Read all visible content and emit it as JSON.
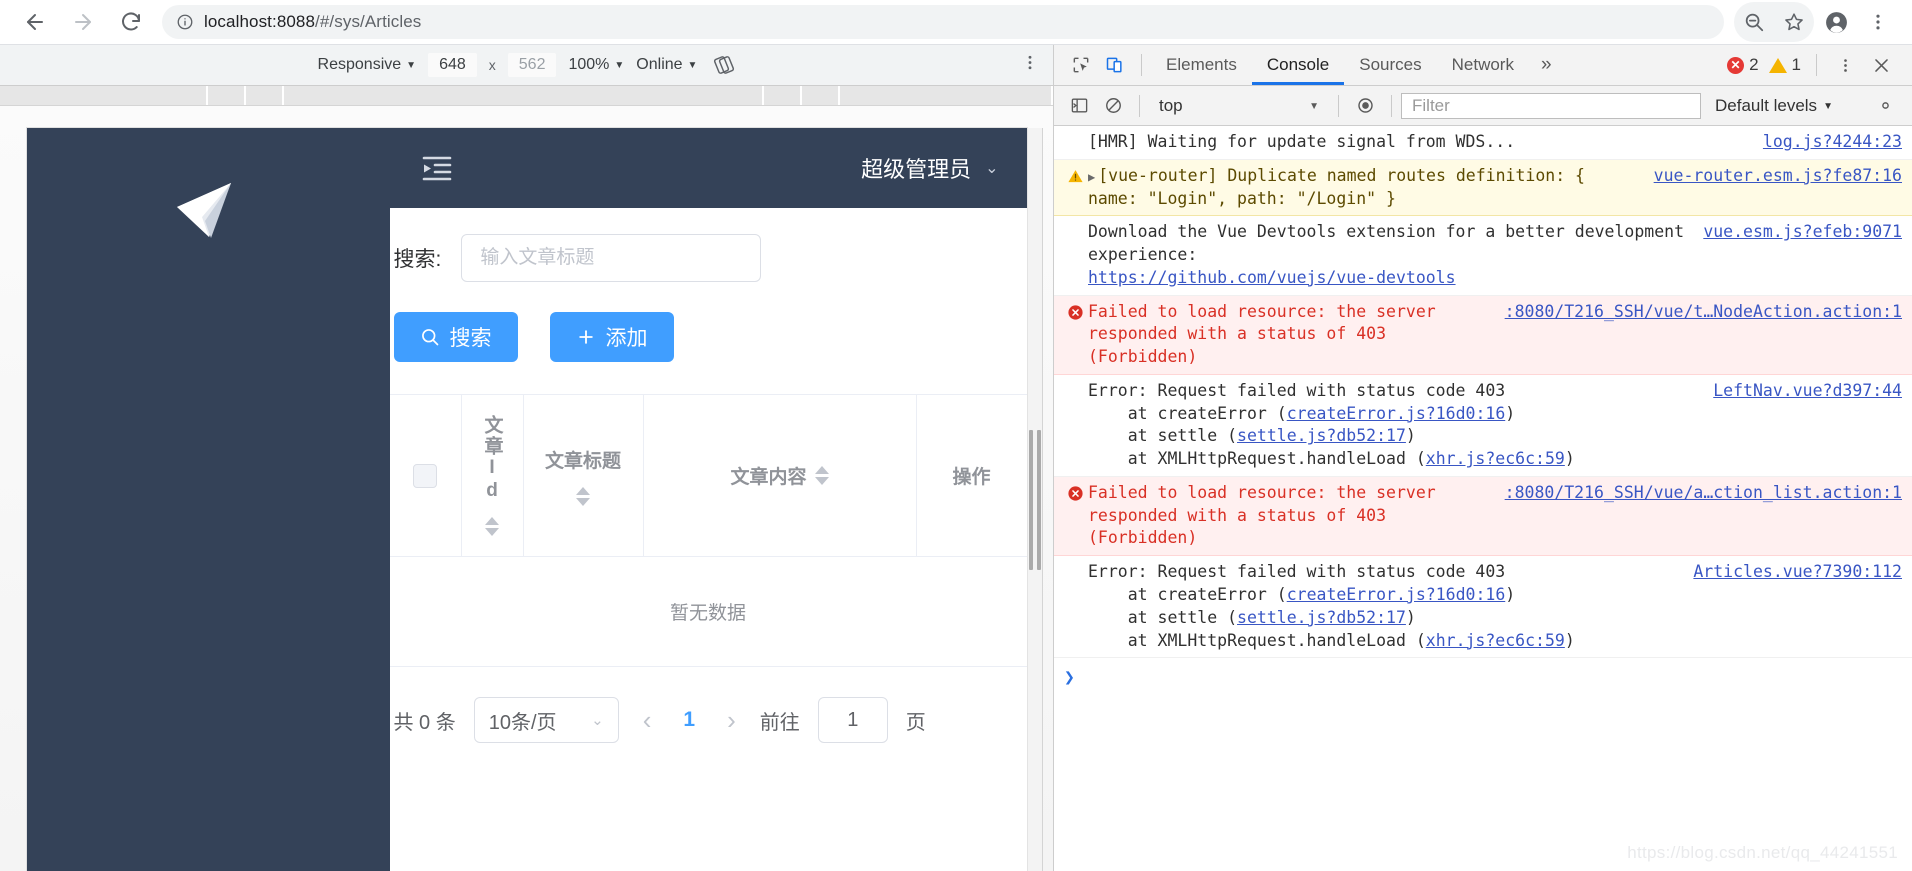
{
  "browser": {
    "back_icon": "arrow-left-icon",
    "forward_icon": "arrow-right-icon",
    "reload_icon": "reload-icon",
    "info_icon": "site-info-icon",
    "url_host": "localhost:8088",
    "url_path": "/#/sys/Articles",
    "url_full": "localhost:8088/#/sys/Articles",
    "zoom_out_icon": "zoom-out-icon",
    "bookmark_icon": "star-icon",
    "profile_icon": "account-avatar-icon",
    "menu_icon": "three-dot-menu-icon"
  },
  "device_toolbar": {
    "device_label": "Responsive",
    "width": "648",
    "height": "562",
    "x_label": "x",
    "zoom_label": "100%",
    "throttle_label": "Online",
    "rotate_icon": "rotate-device-icon",
    "kebab_icon": "three-dot-menu-icon"
  },
  "webapp": {
    "logo_icon": "paper-plane-logo",
    "collapse_icon": "collapse-menu-icon",
    "user_name": "超级管理员",
    "user_caret_icon": "chevron-down-icon",
    "search_label": "搜索:",
    "search_placeholder": "输入文章标题",
    "search_value": "",
    "buttons": {
      "search": {
        "label": "搜索",
        "icon": "search-icon"
      },
      "add": {
        "label": "添加",
        "icon": "plus-icon"
      }
    },
    "table": {
      "columns": [
        {
          "key": "checkbox",
          "label": "",
          "sortable": false
        },
        {
          "key": "id",
          "label": "文章Id",
          "sortable": true
        },
        {
          "key": "title",
          "label": "文章标题",
          "sortable": true
        },
        {
          "key": "content",
          "label": "文章内容",
          "sortable": true
        },
        {
          "key": "ops",
          "label": "操作",
          "sortable": false
        }
      ],
      "rows": [],
      "empty_text": "暂无数据"
    },
    "pagination": {
      "total_text": "共 0 条",
      "page_size_label": "10条/页",
      "prev_icon": "chevron-left-icon",
      "next_icon": "chevron-right-icon",
      "current_page": "1",
      "jump_label": "前往",
      "jump_value": "1",
      "jump_suffix": "页"
    }
  },
  "devtools": {
    "inspect_icon": "inspect-element-icon",
    "device_toggle_icon": "toggle-device-toolbar-icon",
    "tabs": [
      {
        "label": "Elements",
        "selected": false
      },
      {
        "label": "Console",
        "selected": true
      },
      {
        "label": "Sources",
        "selected": false
      },
      {
        "label": "Network",
        "selected": false
      }
    ],
    "more_tabs_icon": "chevron-double-right-icon",
    "error_count": "2",
    "warning_count": "1",
    "kebab_icon": "three-dot-menu-icon",
    "close_icon": "close-icon",
    "filterbar": {
      "sidebar_icon": "console-sidebar-icon",
      "clear_icon": "clear-console-icon",
      "context": "top",
      "eye_icon": "live-expression-icon",
      "filter_placeholder": "Filter",
      "filter_value": "",
      "levels_label": "Default levels",
      "settings_icon": "gear-icon"
    },
    "messages": [
      {
        "level": "log",
        "text": "[HMR] Waiting for update signal from WDS...",
        "source": "log.js?4244:23"
      },
      {
        "level": "warn",
        "icon": "warning-triangle-icon",
        "expand_icon": "disclosure-triangle-icon",
        "text": "[vue-router] Duplicate named routes definition: { name: \"Login\", path: \"/Login\" }",
        "source": "vue-router.esm.js?fe87:16"
      },
      {
        "level": "log",
        "text": "Download the Vue Devtools extension for a better development experience:",
        "link": "https://github.com/vuejs/vue-devtools",
        "source": "vue.esm.js?efeb:9071"
      },
      {
        "level": "error",
        "icon": "error-circle-icon",
        "text": "Failed to load resource: the server responded with a status of 403 (Forbidden)",
        "source": ":8080/T216_SSH/vue/t…NodeAction.action:1"
      },
      {
        "level": "log",
        "text": "Error: Request failed with status code 403",
        "stack": [
          {
            "prefix": "    at createError (",
            "link": "createError.js?16d0:16",
            "suffix": ")"
          },
          {
            "prefix": "    at settle (",
            "link": "settle.js?db52:17",
            "suffix": ")"
          },
          {
            "prefix": "    at XMLHttpRequest.handleLoad (",
            "link": "xhr.js?ec6c:59",
            "suffix": ")"
          }
        ],
        "source": "LeftNav.vue?d397:44"
      },
      {
        "level": "error",
        "icon": "error-circle-icon",
        "text": "Failed to load resource: the server responded with a status of 403 (Forbidden)",
        "source": ":8080/T216_SSH/vue/a…ction_list.action:1"
      },
      {
        "level": "log",
        "text": "Error: Request failed with status code 403",
        "stack": [
          {
            "prefix": "    at createError (",
            "link": "createError.js?16d0:16",
            "suffix": ")"
          },
          {
            "prefix": "    at settle (",
            "link": "settle.js?db52:17",
            "suffix": ")"
          },
          {
            "prefix": "    at XMLHttpRequest.handleLoad (",
            "link": "xhr.js?ec6c:59",
            "suffix": ")"
          }
        ],
        "source": "Articles.vue?7390:112"
      }
    ],
    "prompt_icon": "console-prompt-chevron"
  },
  "watermark": "https://blog.csdn.net/qq_44241551",
  "colors": {
    "accent": "#409eff",
    "sidebar": "#344258",
    "devtools_selected": "#1a73e8",
    "error": "#d93025",
    "warning": "#f5b400"
  }
}
